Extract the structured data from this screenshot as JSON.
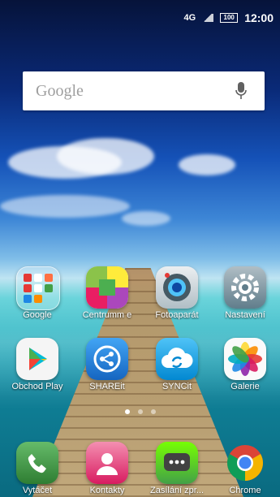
{
  "status_bar": {
    "network": "4G",
    "battery": "100",
    "time": "12:00"
  },
  "search": {
    "placeholder": "Google"
  },
  "apps": [
    {
      "label": "Google",
      "icon": "google-folder-icon"
    },
    {
      "label": "Centrumm e",
      "icon": "centrum-icon"
    },
    {
      "label": "Fotoaparát",
      "icon": "camera-icon"
    },
    {
      "label": "Nastavení",
      "icon": "settings-gear-icon"
    },
    {
      "label": "Obchod Play",
      "icon": "play-store-icon"
    },
    {
      "label": "SHAREit",
      "icon": "shareit-icon"
    },
    {
      "label": "SYNCit",
      "icon": "syncit-cloud-icon"
    },
    {
      "label": "Galerie",
      "icon": "gallery-flower-icon"
    }
  ],
  "dock": [
    {
      "label": "Vytáčet",
      "icon": "phone-icon"
    },
    {
      "label": "Kontakty",
      "icon": "contacts-icon"
    },
    {
      "label": "Zasílání zpr...",
      "icon": "messages-icon"
    },
    {
      "label": "Chrome",
      "icon": "chrome-icon"
    }
  ],
  "page_indicator": {
    "count": 3,
    "active": 1
  },
  "colors": {
    "sky": "#1552b8",
    "sea": "#2bb7c4",
    "search_bg": "#ffffff"
  }
}
